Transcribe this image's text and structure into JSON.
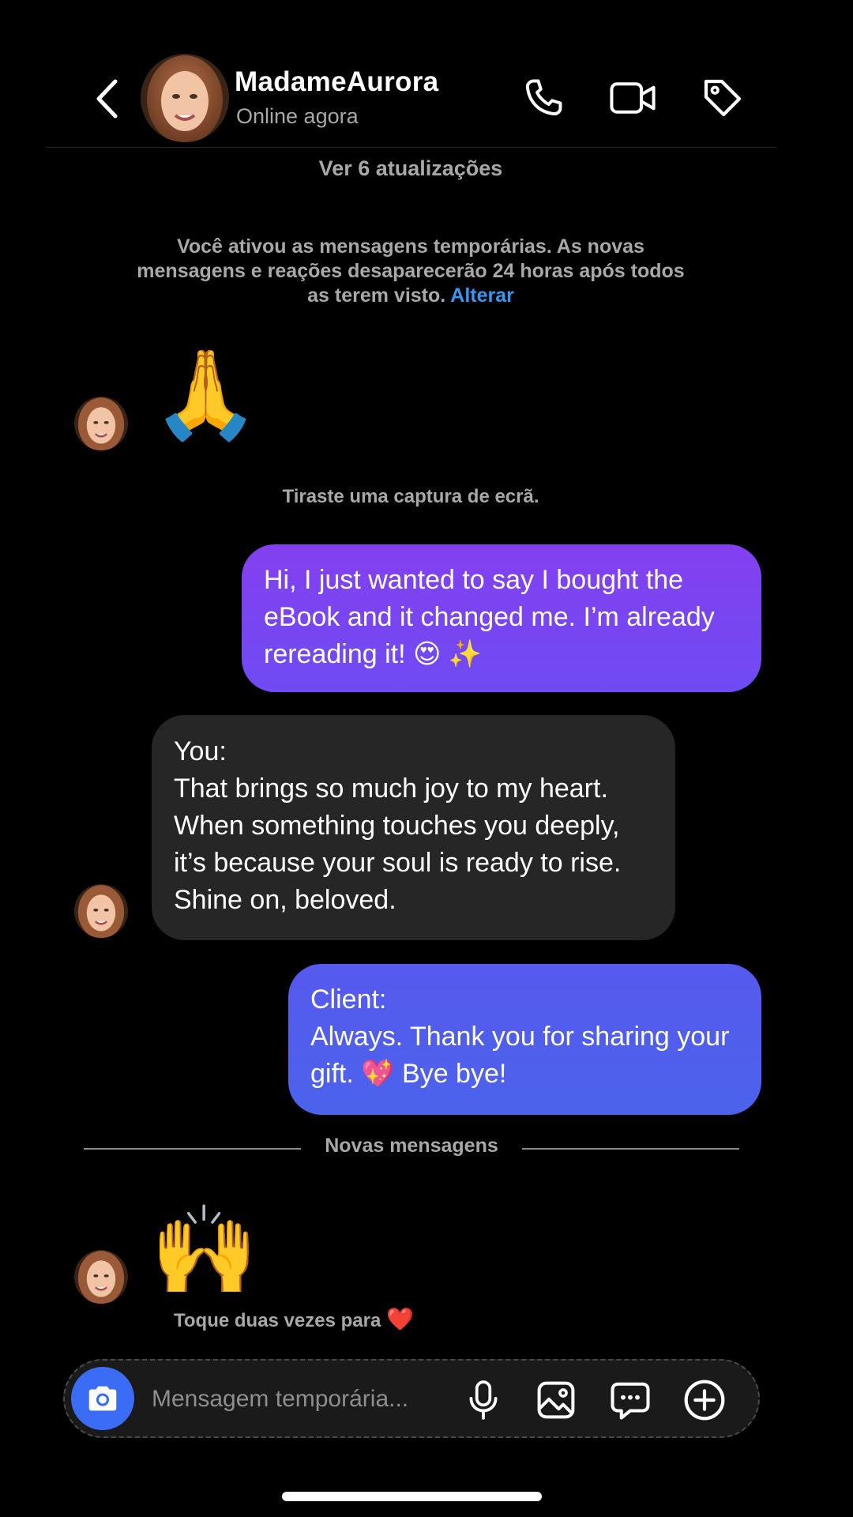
{
  "header": {
    "contact_name": "MadameAurora",
    "status": "Online agora",
    "icons": [
      "back-arrow-icon",
      "phone-icon",
      "video-camera-icon",
      "tag-icon"
    ]
  },
  "thread": {
    "updates_link": "Ver 6 atualizações",
    "temp_notice": "Você ativou as mensagens temporárias. As novas mensagens e reações desaparecerão 24 horas após todos as terem visto.",
    "temp_notice_action": "Alterar",
    "first_emoji": "🙏",
    "screenshot_note": "Tiraste uma captura de ecrã.",
    "messages": [
      {
        "direction": "outgoing",
        "text": "Hi, I just wanted to say I bought the eBook and it changed me. I’m already rereading it! 😍 ✨"
      },
      {
        "direction": "incoming",
        "text": "You:\nThat brings so much joy to my heart. When something touches you deeply, it’s because your soul is ready to rise. Shine on, beloved."
      },
      {
        "direction": "outgoing",
        "text": "Client:\nAlways. Thank you for sharing your gift. 💖 Bye bye!"
      }
    ],
    "new_messages_label": "Novas mensagens",
    "last_emoji": "🙌",
    "double_tap_hint": "Toque duas vezes para",
    "double_tap_heart": "❤️"
  },
  "composer": {
    "placeholder": "Mensagem temporária...",
    "icons": [
      "camera-icon",
      "microphone-icon",
      "gallery-icon",
      "sticker-icon",
      "plus-icon"
    ]
  },
  "colors": {
    "background": "#000000",
    "outgoing_bubble_1": "#7b45f1",
    "outgoing_bubble_2": "#4f5fec",
    "incoming_bubble": "#262626",
    "link_blue": "#3897f0",
    "camera_button": "#3b6cf5",
    "muted_text": "#a8a8a8"
  }
}
